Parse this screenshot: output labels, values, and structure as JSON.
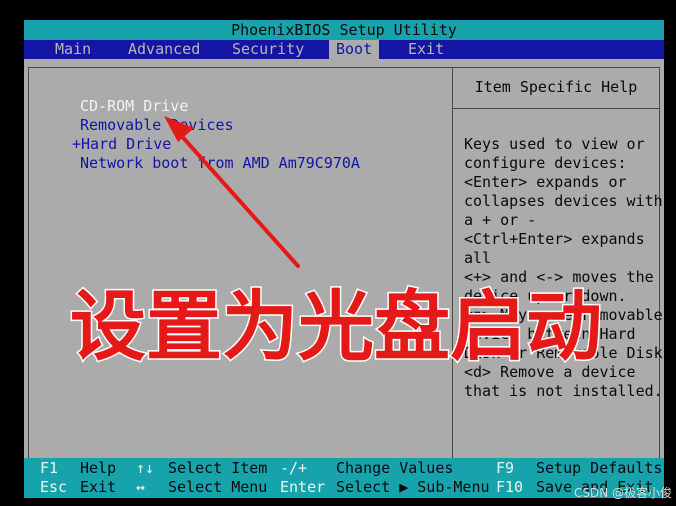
{
  "title": "PhoenixBIOS Setup Utility",
  "menu": [
    {
      "label": "Main"
    },
    {
      "label": "Advanced"
    },
    {
      "label": "Security"
    },
    {
      "label": "Boot",
      "active": true
    },
    {
      "label": "Exit"
    }
  ],
  "boot_order": [
    {
      "label": "CD-ROM Drive",
      "selected": true
    },
    {
      "label": "Removable Devices"
    },
    {
      "label": "+Hard Drive"
    },
    {
      "label": "Network boot from AMD Am79C970A"
    }
  ],
  "help": {
    "title": "Item Specific Help",
    "lines": [
      "Keys used to view or",
      "configure devices:",
      "<Enter> expands or",
      "collapses devices with",
      "a + or -",
      "<Ctrl+Enter> expands",
      "all",
      "<+> and <-> moves the",
      "device up or down.",
      "<n> May move removable",
      "device between Hard",
      "Disk or Removable Disk",
      "<d> Remove a device",
      "that is not installed."
    ]
  },
  "status": {
    "row1": [
      {
        "key": "F1",
        "label": "Help"
      },
      {
        "key": "↑↓",
        "label": "Select Item"
      },
      {
        "key": "-/+",
        "label": "Change Values"
      },
      {
        "key": "F9",
        "label": "Setup Defaults"
      }
    ],
    "row2": [
      {
        "key": "Esc",
        "label": "Exit"
      },
      {
        "key": "↔",
        "label": "Select Menu"
      },
      {
        "key": "Enter",
        "label": "Select ▶ Sub-Menu"
      },
      {
        "key": "F10",
        "label": "Save and Exit"
      }
    ]
  },
  "overlay_text": "设置为光盘启动",
  "watermark": "CSDN @极客小俊",
  "colors": {
    "bios_cyan": "#16a3ab",
    "bios_blue": "#1414a5",
    "bios_gray": "#ababab",
    "annotation_red": "#e61919"
  }
}
